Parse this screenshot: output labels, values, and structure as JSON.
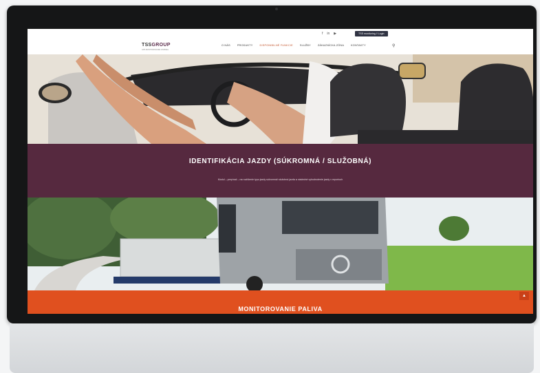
{
  "header": {
    "logo_main": "TSS",
    "logo_rest": "GROUP",
    "logo_tagline": "GPS MONITOROVANIE VOZIDIEL",
    "social_icons": [
      "facebook-icon",
      "linkedin-icon",
      "youtube-icon"
    ],
    "social_glyphs": [
      "f",
      "in",
      "▶"
    ],
    "login_label": "TSS monitoring // Login",
    "menu": [
      {
        "label": "O NÁS"
      },
      {
        "label": "PRODUKTY"
      },
      {
        "label": "DISPONIBILNÉ FUNKCIE",
        "active": true
      },
      {
        "label": "SLUŽBY"
      },
      {
        "label": "ZÁKAZNÍCKA ZÓNA"
      },
      {
        "label": "KONTAKTY"
      }
    ],
    "search_icon": "search-icon"
  },
  "sections": {
    "identification_title": "IDENTIFIKÁCIA JAZDY (SÚKROMNÁ / SLUŽOBNÁ)",
    "identification_text": "Modul – prepínač – na rozlíšenie typu jazdy súkromná/ služobná jazda a následné vyhodnotenie jazdy v reportoch",
    "fuel_title": "MONITOROVANIE PALIVA"
  },
  "colors": {
    "purple_band": "#56293f",
    "orange_band": "#e0501f",
    "active_menu": "#c2532a"
  }
}
